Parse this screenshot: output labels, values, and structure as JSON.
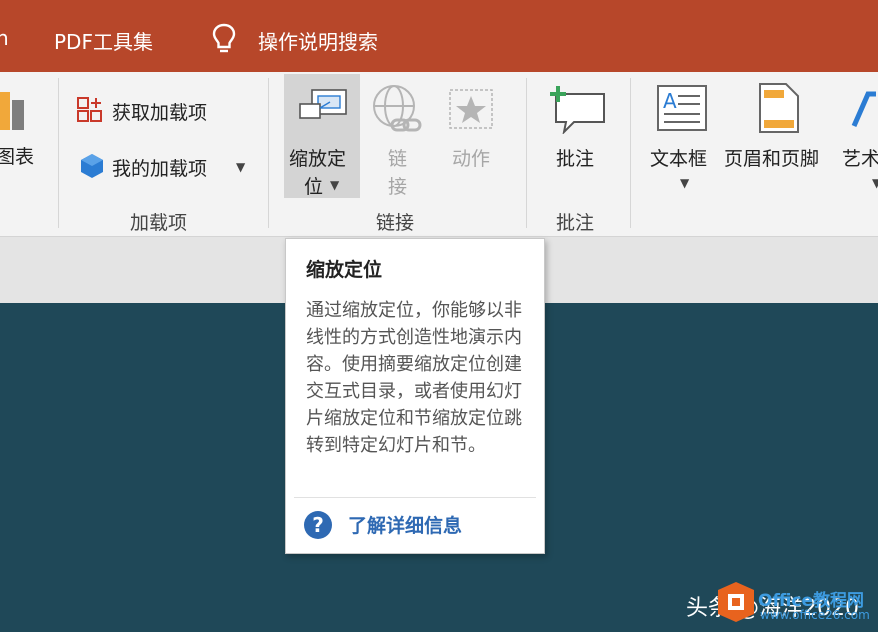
{
  "tabs": {
    "partial": "n",
    "pdf": "PDF工具集",
    "tell_me": "操作说明搜索"
  },
  "ribbon": {
    "left_partial_label": "图表",
    "addins": {
      "get_addins": "获取加载项",
      "my_addins": "我的加载项",
      "group_label": "加载项"
    },
    "links": {
      "zoom_line1": "缩放定",
      "zoom_line2": "位",
      "link_line1": "链",
      "link_line2": "接",
      "action": "动作",
      "group_label": "链接"
    },
    "comments": {
      "comment": "批注",
      "group_label": "批注"
    },
    "text": {
      "textbox": "文本框",
      "header_footer": "页眉和页脚",
      "wordart_partial": "艺术"
    }
  },
  "tooltip": {
    "title": "缩放定位",
    "body": "通过缩放定位，你能够以非线性的方式创造性地演示内容。使用摘要缩放定位创建交互式目录，或者使用幻灯片缩放定位和节缩放定位跳转到特定幻灯片和节。",
    "help_link": "了解详细信息"
  },
  "watermark": {
    "text": "头条 @海洋2020",
    "site": "Office教程网",
    "url": "www.office26.com"
  },
  "colors": {
    "accent": "#b7472a",
    "slide_bg": "#1f4858",
    "link": "#2e69b3"
  }
}
